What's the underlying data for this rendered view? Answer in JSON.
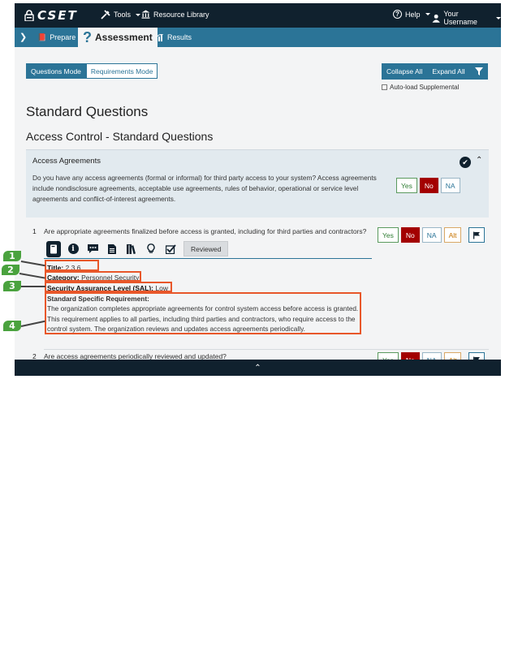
{
  "topbar": {
    "logo": "CSET",
    "tools": "Tools",
    "resource_library": "Resource Library",
    "help": "Help",
    "user": "Your Username"
  },
  "subnav": {
    "prepare": "Prepare",
    "assessment": "Assessment",
    "results": "Results"
  },
  "modes": {
    "questions": "Questions Mode",
    "requirements": "Requirements Mode",
    "collapse_all": "Collapse All",
    "expand_all": "Expand All",
    "auto_load": "Auto-load Supplemental"
  },
  "page": {
    "title": "Standard Questions",
    "section": "Access Control - Standard Questions"
  },
  "group": {
    "title": "Access Agreements",
    "text": "Do you have any access agreements (formal or informal) for third party access to your system? Access agreements include nondisclosure agreements, acceptable use agreements, rules of behavior, operational or service level agreements and conflict-of-interest agreements.",
    "answers": {
      "yes": "Yes",
      "no": "No",
      "na": "NA"
    }
  },
  "question1": {
    "number": "1",
    "text": "Are appropriate agreements finalized before access is granted, including for third parties and contractors?",
    "answers": {
      "yes": "Yes",
      "no": "No",
      "na": "NA",
      "alt": "Alt"
    },
    "reviewed": "Reviewed",
    "title_label": "Title:",
    "title_value": "2.3.6",
    "category_label": "Category:",
    "category_value": "Personnel Security",
    "sal_label": "Security Assurance Level (SAL):",
    "sal_value": "Low",
    "req_label": "Standard Specific Requirement:",
    "req_text": "The organization completes appropriate agreements for control system access before access is granted. This requirement applies to all parties, including third parties and contractors, who require access to the control system. The organization reviews and updates access agreements periodically."
  },
  "question2": {
    "number": "2",
    "text": "Are access agreements periodically reviewed and updated?",
    "answers": {
      "yes": "Yes",
      "no": "No",
      "na": "NA",
      "alt": "Alt"
    }
  },
  "badges": [
    "1",
    "2",
    "3",
    "4"
  ],
  "colors": {
    "navy": "#10212e",
    "teal": "#2b7497",
    "no_red": "#a30000",
    "highlight": "#e8572a",
    "badge_green": "#4aa23e"
  }
}
